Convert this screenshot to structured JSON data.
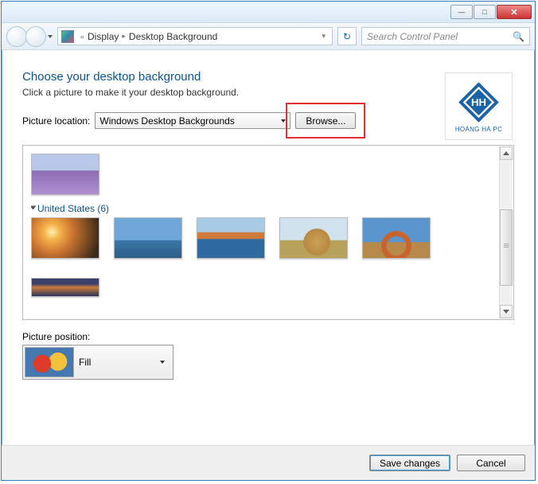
{
  "titlebar": {
    "minimize_icon": "—",
    "maximize_icon": "□",
    "close_icon": "✕"
  },
  "navbar": {
    "overflow_icon": "«",
    "breadcrumb": [
      "Display",
      "Desktop Background"
    ],
    "refresh_icon": "↻",
    "search_placeholder": "Search Control Panel",
    "search_icon": "🔍"
  },
  "main": {
    "heading": "Choose your desktop background",
    "subtitle": "Click a picture to make it your desktop background.",
    "picture_location_label": "Picture location:",
    "picture_location_value": "Windows Desktop Backgrounds",
    "browse_label": "Browse...",
    "logo_text": "HOÀNG HÀ PC",
    "category_label": "United States (6)",
    "position_label": "Picture position:",
    "position_value": "Fill"
  },
  "footer": {
    "save_label": "Save changes",
    "cancel_label": "Cancel"
  }
}
